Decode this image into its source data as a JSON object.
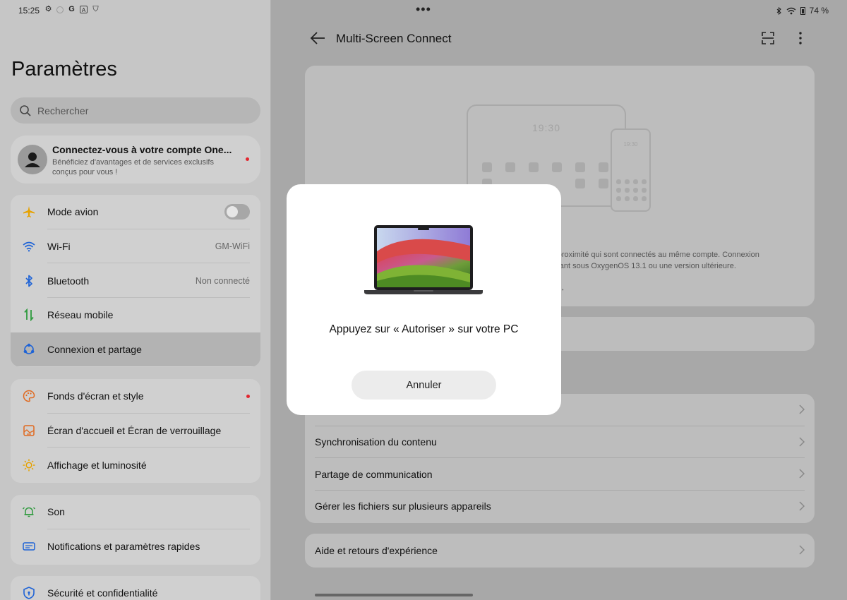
{
  "status_bar": {
    "time": "15:25",
    "left_icons": [
      "gear-icon",
      "circle-icon",
      "google-icon",
      "translate-icon",
      "shield-icon"
    ],
    "battery": "74 %",
    "center_dots": "•••"
  },
  "left": {
    "title": "Paramètres",
    "search": {
      "placeholder": "Rechercher"
    },
    "account": {
      "title": "Connectez-vous à votre compte One...",
      "subtitle": "Bénéficiez d'avantages et de services exclusifs conçus pour vous !"
    },
    "group1": [
      {
        "label": "Mode avion",
        "icon": "airplane-icon",
        "value": ""
      },
      {
        "label": "Wi-Fi",
        "icon": "wifi-icon",
        "value": "GM-WiFi"
      },
      {
        "label": "Bluetooth",
        "icon": "bluetooth-icon",
        "value": "Non connecté"
      },
      {
        "label": "Réseau mobile",
        "icon": "mobile-network-icon",
        "value": ""
      },
      {
        "label": "Connexion et partage",
        "icon": "connection-sharing-icon",
        "value": ""
      }
    ],
    "group2": [
      {
        "label": "Fonds d'écran et style",
        "icon": "palette-icon"
      },
      {
        "label": "Écran d'accueil et Écran de verrouillage",
        "icon": "home-screen-icon"
      },
      {
        "label": "Affichage et luminosité",
        "icon": "brightness-icon"
      }
    ],
    "group3": [
      {
        "label": "Son",
        "icon": "bell-icon"
      },
      {
        "label": "Notifications et paramètres rapides",
        "icon": "notifications-icon"
      }
    ],
    "group4": [
      {
        "label": "Sécurité et confidentialité",
        "icon": "security-icon"
      }
    ]
  },
  "right": {
    "title": "Multi-Screen Connect",
    "illustration": {
      "tablet_time": "19:30",
      "phone_time": "19:30",
      "description_line1": "s à proximité qui sont connectés au même compte. Connexion",
      "description_line2": "ionnant sous OxygenOS 13.1 ou une version ultérieure."
    },
    "list": [
      "",
      "Synchronisation du contenu",
      "Partage de communication",
      "Gérer les fichiers sur plusieurs appareils"
    ],
    "help": "Aide et retours d'expérience"
  },
  "dialog": {
    "message": "Appuyez sur « Autoriser » sur votre PC",
    "cancel": "Annuler"
  },
  "colors": {
    "airplane": "#e6a200",
    "wifi": "#1e63d6",
    "bluetooth": "#1e63d6",
    "mobile": "#2e9a3d",
    "connection": "#1e63d6",
    "palette": "#e0691f",
    "home": "#e0691f",
    "brightness": "#e6a200",
    "sound": "#2e9a3d",
    "notifications": "#1e63d6",
    "security": "#1e63d6",
    "badge": "#e3262f"
  }
}
